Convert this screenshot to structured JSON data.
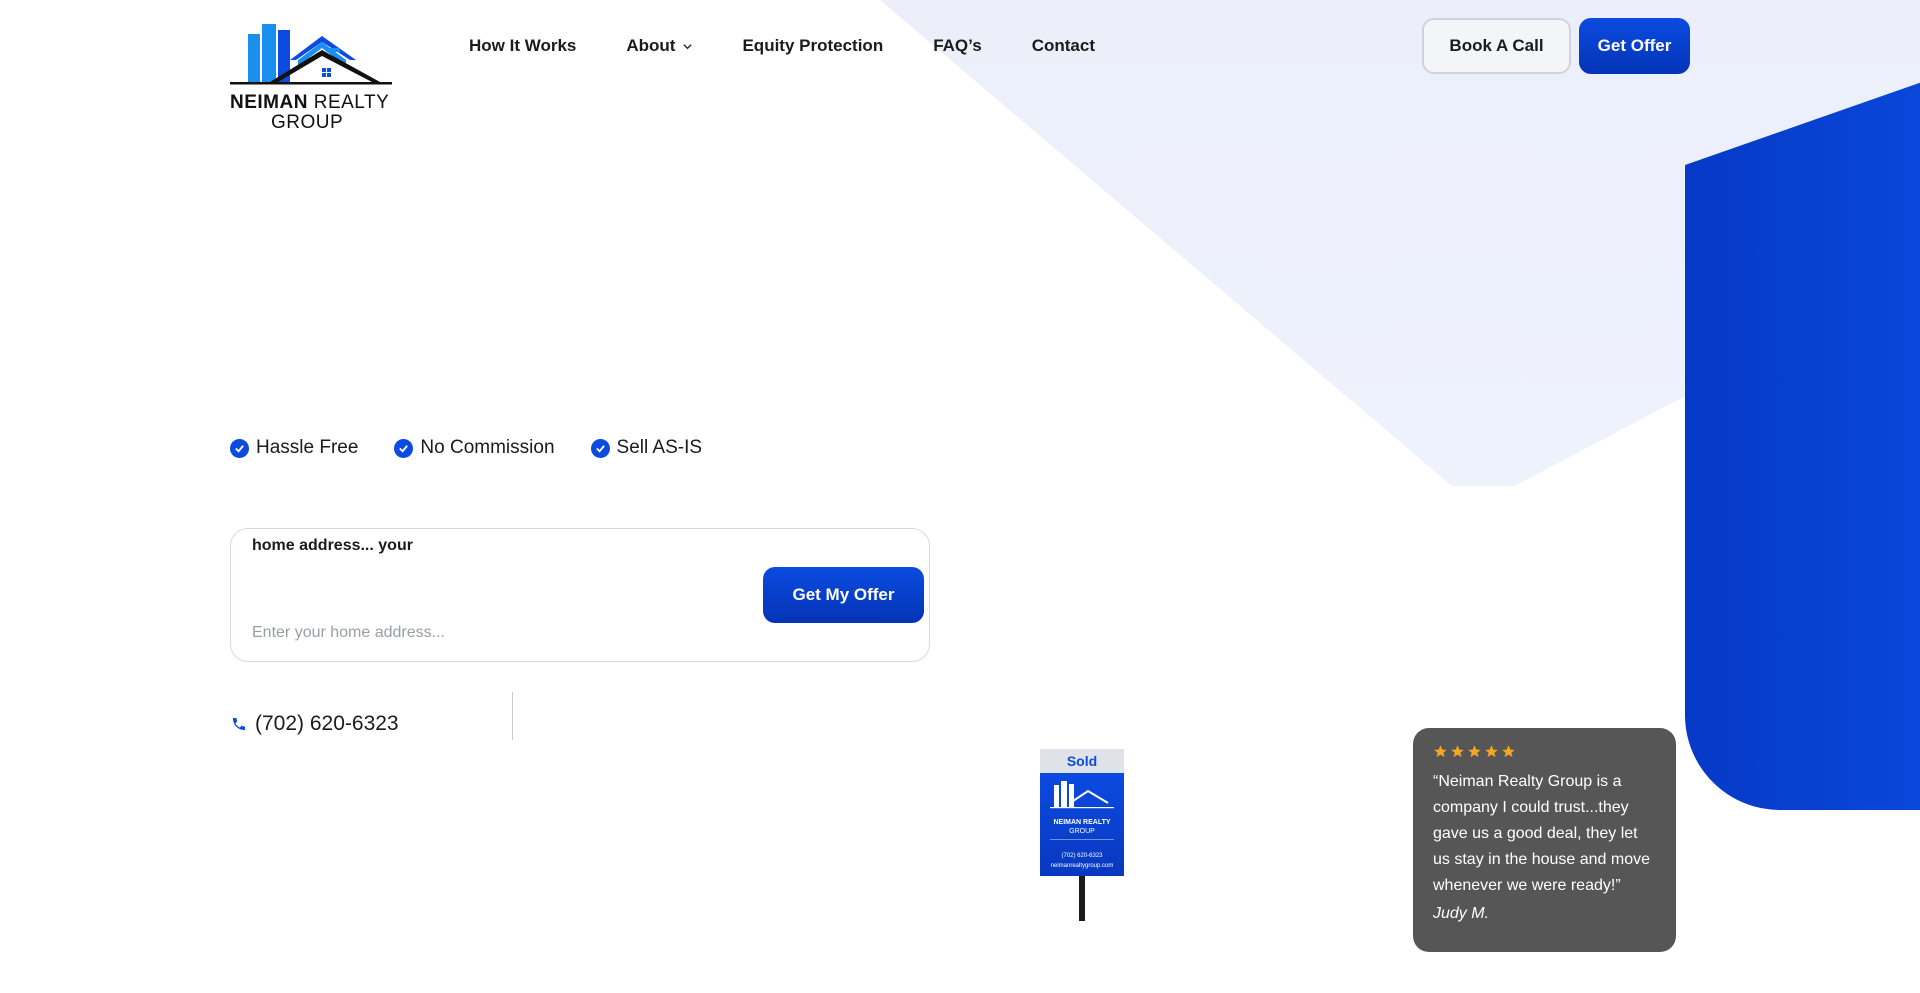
{
  "brand": {
    "name_bold": "NEIMAN",
    "name_regular": "REALTY",
    "name_line2": "GROUP",
    "colors": {
      "primary": "#0b4be0",
      "primary_dark": "#0434b6",
      "light_bg": "#eceff9"
    }
  },
  "nav": {
    "items": [
      {
        "label": "How It Works",
        "has_dropdown": false
      },
      {
        "label": "About",
        "has_dropdown": true,
        "icon": "chevron-down-icon"
      },
      {
        "label": "Equity Protection",
        "has_dropdown": false
      },
      {
        "label": "FAQ’s",
        "has_dropdown": false
      },
      {
        "label": "Contact",
        "has_dropdown": false
      }
    ],
    "book_call_label": "Book A Call",
    "get_offer_label": "Get Offer"
  },
  "features": [
    {
      "label": "Hassle Free",
      "icon": "check-circle-icon"
    },
    {
      "label": "No Commission",
      "icon": "check-circle-icon"
    },
    {
      "label": "Sell AS-IS",
      "icon": "check-circle-icon"
    }
  ],
  "address_form": {
    "label": "home address... your",
    "placeholder": "Enter your home address...",
    "value": "",
    "submit_label": "Get My Offer"
  },
  "contact": {
    "phone": "(702) 620-6323",
    "icon": "phone-icon"
  },
  "sign": {
    "sold_label": "Sold",
    "name_bold": "NEIMAN",
    "name_regular": "REALTY",
    "name_line2": "GROUP",
    "phone": "(702) 620-6323",
    "website": "neimanrealtygroup.com"
  },
  "review": {
    "rating": 5,
    "star_color": "#f5a623",
    "text": "“Neiman Realty Group is a company I could trust...they gave us a good deal, they let us stay in the house and move whenever we were ready!”",
    "author": "Judy M."
  }
}
